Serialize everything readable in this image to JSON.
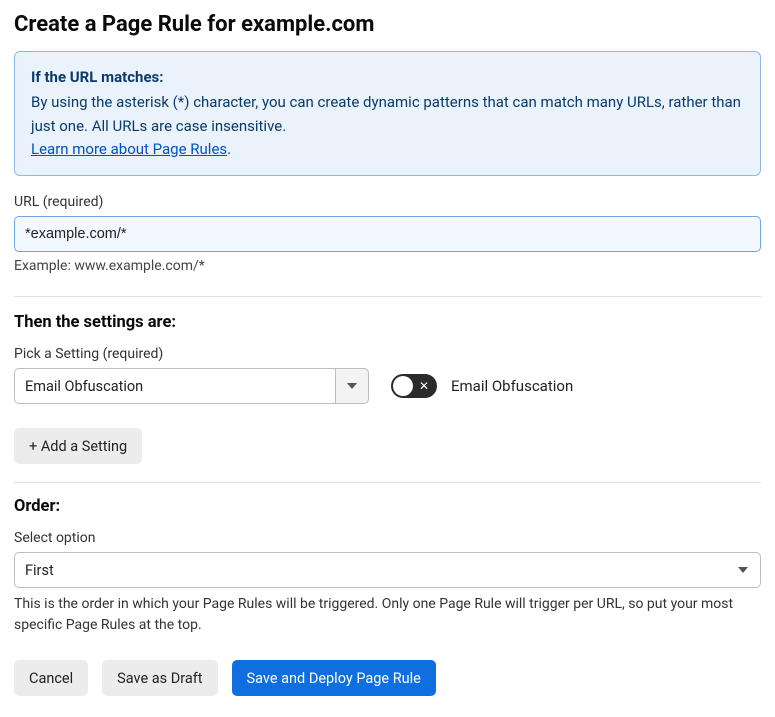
{
  "title": "Create a Page Rule for example.com",
  "info": {
    "heading": "If the URL matches:",
    "body": "By using the asterisk (*) character, you can create dynamic patterns that can match many URLs, rather than just one. All URLs are case insensitive.",
    "learn_text": "Learn more about Page Rules",
    "period": "."
  },
  "url": {
    "label": "URL (required)",
    "value": "*example.com/*",
    "hint": "Example: www.example.com/*"
  },
  "settings": {
    "section_title": "Then the settings are:",
    "pick_label": "Pick a Setting (required)",
    "selected": "Email Obfuscation",
    "toggle_label": "Email Obfuscation",
    "toggle_state": "off",
    "add_button": "+ Add a Setting"
  },
  "order": {
    "section_title": "Order:",
    "label": "Select option",
    "selected": "First",
    "help": "This is the order in which your Page Rules will be triggered. Only one Page Rule will trigger per URL, so put your most specific Page Rules at the top."
  },
  "footer": {
    "cancel": "Cancel",
    "draft": "Save as Draft",
    "deploy": "Save and Deploy Page Rule"
  }
}
